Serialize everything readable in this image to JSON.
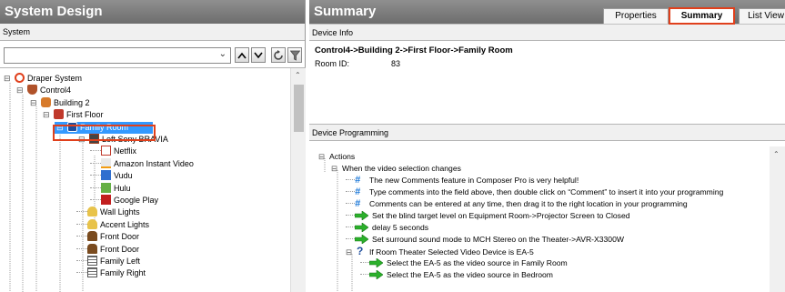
{
  "left_panel": {
    "title": "System Design",
    "subheader": "System",
    "buttons": {
      "up": "^",
      "down": "v",
      "refresh": "refresh-icon",
      "filter": "filter-icon"
    },
    "tree": [
      {
        "label": "Draper System",
        "icon": "system-icon"
      },
      {
        "label": "Control4",
        "icon": "control4-icon"
      },
      {
        "label": "Building 2",
        "icon": "building-icon"
      },
      {
        "label": "First Floor",
        "icon": "floor-icon"
      },
      {
        "label": "Family Room",
        "icon": "room-icon",
        "selected": true
      },
      {
        "label": "Left Sony BRAVIA",
        "icon": "tv-icon"
      },
      {
        "label": "Netflix",
        "icon": "netflix-icon"
      },
      {
        "label": "Amazon Instant Video",
        "icon": "amazon-icon"
      },
      {
        "label": "Vudu",
        "icon": "vudu-icon"
      },
      {
        "label": "Hulu",
        "icon": "hulu-icon"
      },
      {
        "label": "Google Play",
        "icon": "google-play-icon"
      },
      {
        "label": "Wall Lights",
        "icon": "light-icon"
      },
      {
        "label": "Accent Lights",
        "icon": "light-icon"
      },
      {
        "label": "Front Door",
        "icon": "door-icon"
      },
      {
        "label": "Front Door",
        "icon": "door-icon"
      },
      {
        "label": "Family Left",
        "icon": "shade-icon"
      },
      {
        "label": "Family Right",
        "icon": "shade-icon"
      }
    ]
  },
  "right_panel": {
    "title": "Summary",
    "tabs": [
      "Properties",
      "Summary",
      "List View"
    ],
    "active_tab": "Summary",
    "device_info_header": "Device Info",
    "device_path": "Control4->Building 2->First Floor->Family Room",
    "room_id_label": "Room ID:",
    "room_id_value": "83",
    "programming_header": "Device Programming",
    "programming": [
      {
        "text": "Actions",
        "type": "root"
      },
      {
        "text": "When the video selection changes",
        "type": "event"
      },
      {
        "text": "The new Comments feature in Composer Pro is very helpful!",
        "type": "comment"
      },
      {
        "text": "Type comments into the field above, then double click on “Comment” to insert it into your programming",
        "type": "comment"
      },
      {
        "text": "Comments can be entered at any time, then drag it to the right location in your programming",
        "type": "comment"
      },
      {
        "text": "Set the blind target level on Equipment Room->Projector Screen to Closed",
        "type": "command"
      },
      {
        "text": "delay 5 seconds",
        "type": "command"
      },
      {
        "text": "Set surround sound mode to MCH Stereo on the Theater->AVR-X3300W",
        "type": "command"
      },
      {
        "text": "If Room Theater Selected Video Device is EA-5",
        "type": "conditional"
      },
      {
        "text": "Select the EA-5 as the video source in Family Room",
        "type": "command"
      },
      {
        "text": "Select the EA-5 as the video source in Bedroom",
        "type": "command"
      }
    ]
  },
  "colors": {
    "banner": "#7a7a7a",
    "selection": "#3399ff",
    "highlight_border": "#e0401c",
    "comment": "#1c78d8",
    "command": "#2bb02b"
  }
}
